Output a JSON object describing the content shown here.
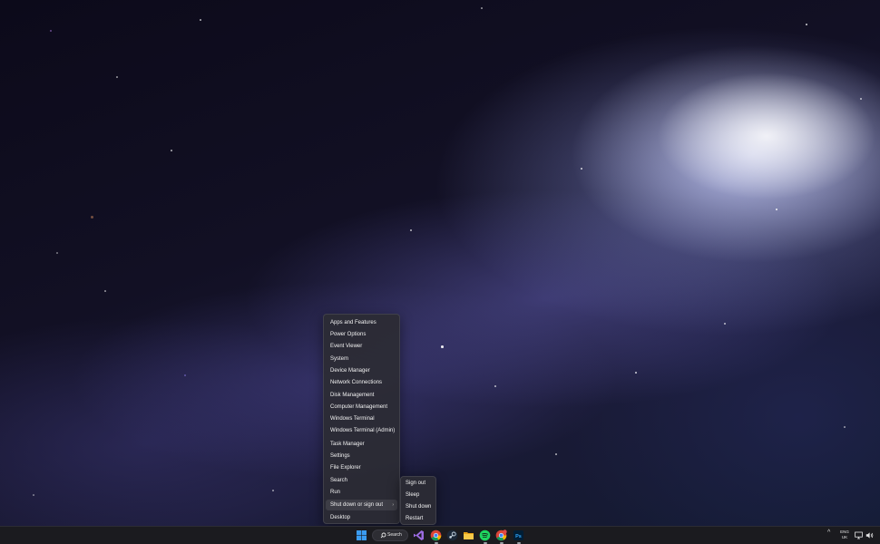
{
  "context_menu": {
    "items": [
      {
        "label": "Apps and Features"
      },
      {
        "label": "Power Options"
      },
      {
        "label": "Event Viewer"
      },
      {
        "label": "System"
      },
      {
        "label": "Device Manager"
      },
      {
        "label": "Network Connections"
      },
      {
        "label": "Disk Management"
      },
      {
        "label": "Computer Management"
      },
      {
        "label": "Windows Terminal"
      },
      {
        "label": "Windows Terminal (Admin)"
      },
      {
        "label": "Task Manager"
      },
      {
        "label": "Settings"
      },
      {
        "label": "File Explorer"
      },
      {
        "label": "Search"
      },
      {
        "label": "Run"
      },
      {
        "label": "Shut down or sign out",
        "has_submenu": true
      },
      {
        "label": "Desktop"
      }
    ],
    "submenu_arrow": "›"
  },
  "shutdown_submenu": {
    "items": [
      {
        "label": "Sign out"
      },
      {
        "label": "Sleep"
      },
      {
        "label": "Shut down"
      },
      {
        "label": "Restart"
      }
    ]
  },
  "taskbar": {
    "search_label": "Search",
    "pinned": [
      {
        "icon": "windows-start-icon"
      },
      {
        "icon": "search-icon"
      },
      {
        "icon": "visual-studio-icon"
      },
      {
        "icon": "chrome-icon"
      },
      {
        "icon": "steam-icon"
      },
      {
        "icon": "file-explorer-icon"
      },
      {
        "icon": "spotify-icon"
      },
      {
        "icon": "chrome-profile-icon"
      },
      {
        "icon": "photoshop-icon"
      }
    ],
    "tray": {
      "chevron": "^",
      "language": "ENG",
      "region": "UK"
    }
  },
  "colors": {
    "menu_bg": "#2c2c34",
    "taskbar_bg": "#1b1b1f",
    "windows_blue": "#3a9bf0",
    "spotify_green": "#1ed760",
    "photoshop_blue": "#31a8ff"
  }
}
